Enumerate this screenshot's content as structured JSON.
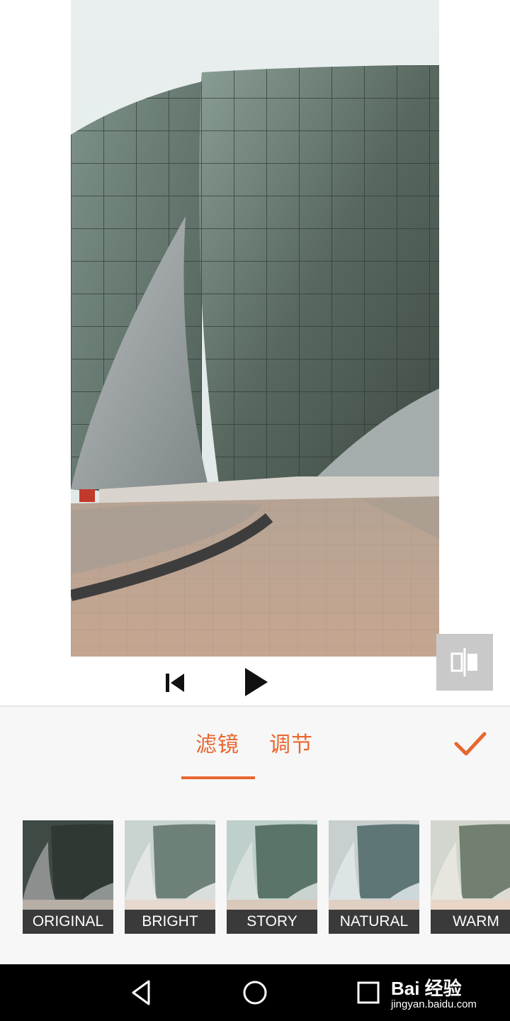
{
  "preview": {
    "image_alt": "",
    "controls": [
      "previous-frame",
      "play"
    ]
  },
  "compare": {
    "icon": "compare-icon"
  },
  "tabs": [
    {
      "label": "滤镜",
      "active": true
    },
    {
      "label": "调节",
      "active": false
    }
  ],
  "confirm": {
    "icon": "check-icon"
  },
  "filters": [
    {
      "label": "ORIGINAL"
    },
    {
      "label": "BRIGHT"
    },
    {
      "label": "STORY"
    },
    {
      "label": "NATURAL"
    },
    {
      "label": "WARM"
    }
  ],
  "nav": {
    "buttons": [
      "back",
      "home",
      "recent"
    ]
  },
  "watermark": {
    "brand": "Bai 经验",
    "url": "jingyan.baidu.com"
  },
  "colors": {
    "accent": "#e8672f",
    "panel": "#f7f7f7",
    "label_bg": "#3a3a3a"
  }
}
